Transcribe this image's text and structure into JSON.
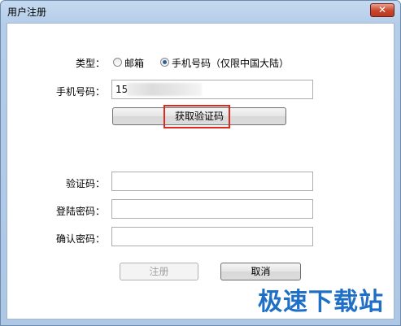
{
  "window": {
    "title": "用户注册",
    "close_symbol": "✕"
  },
  "form": {
    "type_label": "类型：",
    "type_options": [
      {
        "label": "邮箱",
        "selected": false
      },
      {
        "label": "手机号码（仅限中国大陆）",
        "selected": true
      }
    ],
    "phone_label": "手机号码：",
    "phone_value": "15",
    "get_code_button": "获取验证码",
    "code_label": "验证码：",
    "code_value": "",
    "password_label": "登陆密码：",
    "password_value": "",
    "confirm_label": "确认密码：",
    "confirm_value": ""
  },
  "actions": {
    "register": "注册",
    "cancel": "取消"
  },
  "watermark": "极速下载站",
  "colors": {
    "highlight": "#e0281e",
    "watermark": "#1e6fc5"
  }
}
